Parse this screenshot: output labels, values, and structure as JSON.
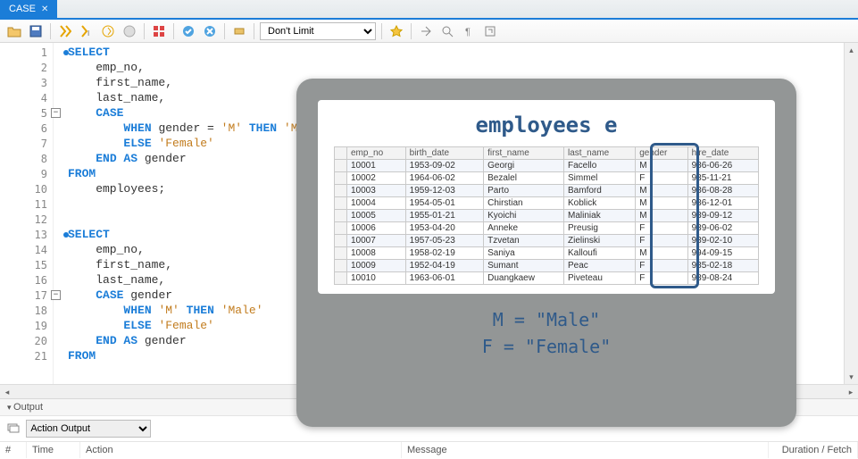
{
  "tab": {
    "label": "CASE"
  },
  "toolbar": {
    "limit_options": [
      "Don't Limit"
    ],
    "limit_selected": "Don't Limit"
  },
  "code_lines": [
    {
      "n": 1,
      "dot": true,
      "fold": null,
      "tokens": [
        {
          "t": "SELECT",
          "c": "kw"
        }
      ]
    },
    {
      "n": 2,
      "dot": false,
      "fold": null,
      "tokens": [
        {
          "t": "    emp_no,",
          "c": "ident"
        }
      ]
    },
    {
      "n": 3,
      "dot": false,
      "fold": null,
      "tokens": [
        {
          "t": "    first_name,",
          "c": "ident"
        }
      ]
    },
    {
      "n": 4,
      "dot": false,
      "fold": null,
      "tokens": [
        {
          "t": "    last_name,",
          "c": "ident"
        }
      ]
    },
    {
      "n": 5,
      "dot": false,
      "fold": "-",
      "tokens": [
        {
          "t": "    ",
          "c": "ident"
        },
        {
          "t": "CASE",
          "c": "kw"
        }
      ]
    },
    {
      "n": 6,
      "dot": false,
      "fold": null,
      "tokens": [
        {
          "t": "        ",
          "c": "ident"
        },
        {
          "t": "WHEN",
          "c": "kw"
        },
        {
          "t": " gender = ",
          "c": "ident"
        },
        {
          "t": "'M'",
          "c": "str"
        },
        {
          "t": " ",
          "c": "ident"
        },
        {
          "t": "THEN",
          "c": "kw"
        },
        {
          "t": " ",
          "c": "ident"
        },
        {
          "t": "'Male'",
          "c": "str"
        }
      ]
    },
    {
      "n": 7,
      "dot": false,
      "fold": null,
      "tokens": [
        {
          "t": "        ",
          "c": "ident"
        },
        {
          "t": "ELSE",
          "c": "kw"
        },
        {
          "t": " ",
          "c": "ident"
        },
        {
          "t": "'Female'",
          "c": "str"
        }
      ]
    },
    {
      "n": 8,
      "dot": false,
      "fold": null,
      "tokens": [
        {
          "t": "    ",
          "c": "ident"
        },
        {
          "t": "END AS",
          "c": "kw"
        },
        {
          "t": " gender",
          "c": "ident"
        }
      ]
    },
    {
      "n": 9,
      "dot": false,
      "fold": null,
      "tokens": [
        {
          "t": "FROM",
          "c": "kw"
        }
      ]
    },
    {
      "n": 10,
      "dot": false,
      "fold": null,
      "tokens": [
        {
          "t": "    employees;",
          "c": "ident"
        }
      ]
    },
    {
      "n": 11,
      "dot": false,
      "fold": null,
      "tokens": []
    },
    {
      "n": 12,
      "dot": false,
      "fold": null,
      "tokens": []
    },
    {
      "n": 13,
      "dot": true,
      "fold": null,
      "tokens": [
        {
          "t": "SELECT",
          "c": "kw"
        }
      ]
    },
    {
      "n": 14,
      "dot": false,
      "fold": null,
      "tokens": [
        {
          "t": "    emp_no,",
          "c": "ident"
        }
      ]
    },
    {
      "n": 15,
      "dot": false,
      "fold": null,
      "tokens": [
        {
          "t": "    first_name,",
          "c": "ident"
        }
      ]
    },
    {
      "n": 16,
      "dot": false,
      "fold": null,
      "tokens": [
        {
          "t": "    last_name,",
          "c": "ident"
        }
      ]
    },
    {
      "n": 17,
      "dot": false,
      "fold": "-",
      "tokens": [
        {
          "t": "    ",
          "c": "ident"
        },
        {
          "t": "CASE",
          "c": "kw"
        },
        {
          "t": " gender",
          "c": "ident"
        }
      ]
    },
    {
      "n": 18,
      "dot": false,
      "fold": null,
      "tokens": [
        {
          "t": "        ",
          "c": "ident"
        },
        {
          "t": "WHEN",
          "c": "kw"
        },
        {
          "t": " ",
          "c": "ident"
        },
        {
          "t": "'M'",
          "c": "str"
        },
        {
          "t": " ",
          "c": "ident"
        },
        {
          "t": "THEN",
          "c": "kw"
        },
        {
          "t": " ",
          "c": "ident"
        },
        {
          "t": "'Male'",
          "c": "str"
        }
      ]
    },
    {
      "n": 19,
      "dot": false,
      "fold": null,
      "tokens": [
        {
          "t": "        ",
          "c": "ident"
        },
        {
          "t": "ELSE",
          "c": "kw"
        },
        {
          "t": " ",
          "c": "ident"
        },
        {
          "t": "'Female'",
          "c": "str"
        }
      ]
    },
    {
      "n": 20,
      "dot": false,
      "fold": null,
      "tokens": [
        {
          "t": "    ",
          "c": "ident"
        },
        {
          "t": "END AS",
          "c": "kw"
        },
        {
          "t": " gender",
          "c": "ident"
        }
      ]
    },
    {
      "n": 21,
      "dot": false,
      "fold": null,
      "tokens": [
        {
          "t": "FROM",
          "c": "kw"
        }
      ]
    }
  ],
  "output": {
    "header": "Output",
    "dropdown": "Action Output",
    "cols": {
      "num": "#",
      "time": "Time",
      "action": "Action",
      "message": "Message",
      "duration": "Duration / Fetch"
    }
  },
  "overlay": {
    "title": "employees e",
    "legend1": "M = \"Male\"",
    "legend2": "F = \"Female\"",
    "headers": [
      "emp_no",
      "birth_date",
      "first_name",
      "last_name",
      "gender",
      "hire_date"
    ],
    "rows": [
      [
        "10001",
        "1953-09-02",
        "Georgi",
        "Facello",
        "M",
        "986-06-26"
      ],
      [
        "10002",
        "1964-06-02",
        "Bezalel",
        "Simmel",
        "F",
        "985-11-21"
      ],
      [
        "10003",
        "1959-12-03",
        "Parto",
        "Bamford",
        "M",
        "986-08-28"
      ],
      [
        "10004",
        "1954-05-01",
        "Chirstian",
        "Koblick",
        "M",
        "986-12-01"
      ],
      [
        "10005",
        "1955-01-21",
        "Kyoichi",
        "Maliniak",
        "M",
        "989-09-12"
      ],
      [
        "10006",
        "1953-04-20",
        "Anneke",
        "Preusig",
        "F",
        "989-06-02"
      ],
      [
        "10007",
        "1957-05-23",
        "Tzvetan",
        "Zielinski",
        "F",
        "989-02-10"
      ],
      [
        "10008",
        "1958-02-19",
        "Saniya",
        "Kalloufi",
        "M",
        "994-09-15"
      ],
      [
        "10009",
        "1952-04-19",
        "Sumant",
        "Peac",
        "F",
        "985-02-18"
      ],
      [
        "10010",
        "1963-06-01",
        "Duangkaew",
        "Piveteau",
        "F",
        "989-08-24"
      ]
    ]
  }
}
